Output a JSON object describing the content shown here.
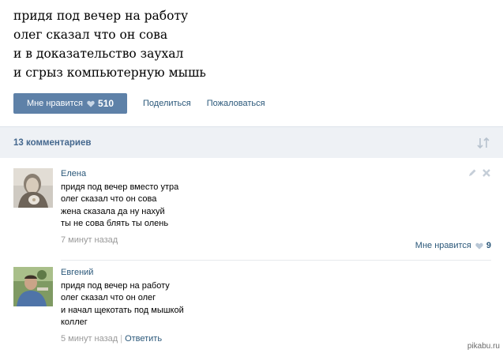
{
  "post": {
    "lines": [
      "придя под вечер на работу",
      "олег сказал что он сова",
      "и в доказательство заухал",
      "и сгрыз компьютерную мышь"
    ]
  },
  "actions": {
    "like_label": "Мне нравится",
    "like_count": "510",
    "share_label": "Поделиться",
    "report_label": "Пожаловаться"
  },
  "comments_header": {
    "count_label": "13 комментариев"
  },
  "comments": [
    {
      "author": "Елена",
      "lines": [
        "придя под вечер вместо утра",
        "олег сказал что он сова",
        "жена сказала да ну нахуй",
        "ты не сова блять ты олень"
      ],
      "time": "7 минут назад",
      "like_label": "Мне нравится",
      "like_count": "9"
    },
    {
      "author": "Евгений",
      "lines": [
        "придя под вечер на работу",
        "олег сказал что он олег",
        "и начал щекотать под мышкой",
        "коллег"
      ],
      "time": "5 минут назад",
      "reply_label": "Ответить"
    }
  ],
  "watermark": "pikabu.ru",
  "colors": {
    "like_button": "#5e81a8",
    "link": "#2b587a",
    "header_bg": "#eef1f5",
    "meta_gray": "#999999"
  }
}
